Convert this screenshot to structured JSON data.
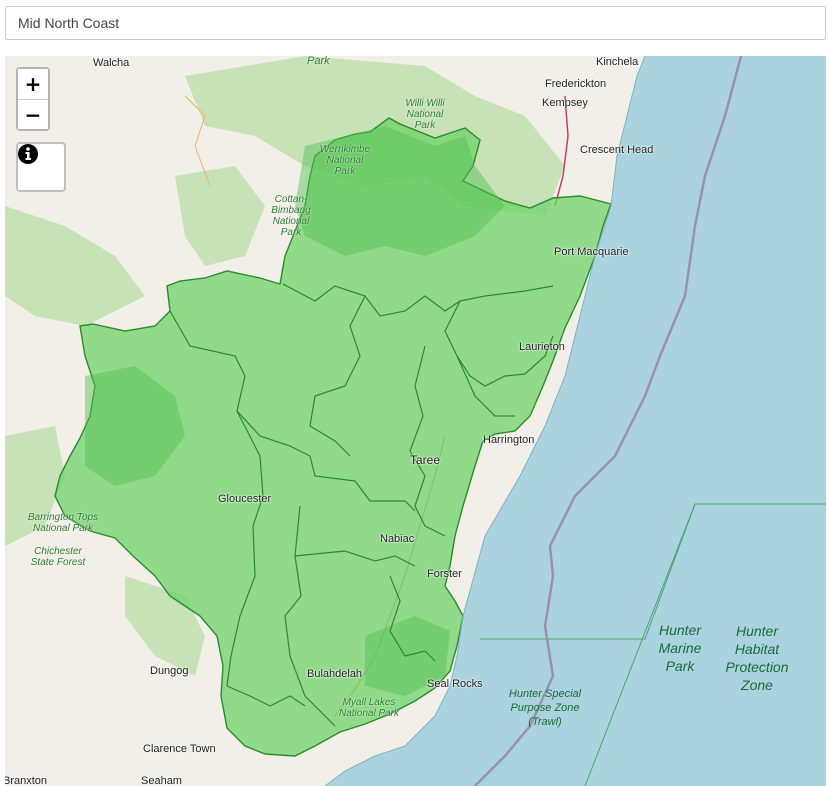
{
  "search": {
    "value": "Mid North Coast"
  },
  "controls": {
    "zoom_in": "+",
    "zoom_out": "−",
    "info_icon": "info-circle-icon"
  },
  "colors": {
    "region_fill": "#6fd36a",
    "region_border": "#2c8a2c",
    "ocean": "#aad3df",
    "land": "#f2efe9",
    "forest": "#c8e2b8"
  },
  "places": {
    "walcha": "Walcha",
    "kinchela": "Kinchela",
    "frederickton": "Frederickton",
    "kempsey": "Kempsey",
    "crescent_head": "Crescent Head",
    "port_macquarie": "Port Macquarie",
    "laurieton": "Laurieton",
    "harrington": "Harrington",
    "taree": "Taree",
    "gloucester": "Gloucester",
    "nabiac": "Nabiac",
    "forster": "Forster",
    "dungog": "Dungog",
    "bulahdelah": "Bulahdelah",
    "seal_rocks": "Seal Rocks",
    "clarence_town": "Clarence Town",
    "seaham": "Seaham",
    "branxton": "Branxton"
  },
  "parks": {
    "park_top": "Park",
    "willi_willi": "Willi Willi National Park",
    "werrikimbe": "Werrikimbe National Park",
    "cottan_bimbang": "Cottan-Bimbang National Park",
    "barrington": "Barrington Tops National Park",
    "chichester": "Chichester State Forest",
    "myall_lakes": "Myall Lakes National Park"
  },
  "marine": {
    "hunter_marine_park": "Hunter Marine Park",
    "hunter_habitat": "Hunter Habitat Protection Zone",
    "hunter_special": "Hunter Special Purpose Zone (Trawl)"
  }
}
